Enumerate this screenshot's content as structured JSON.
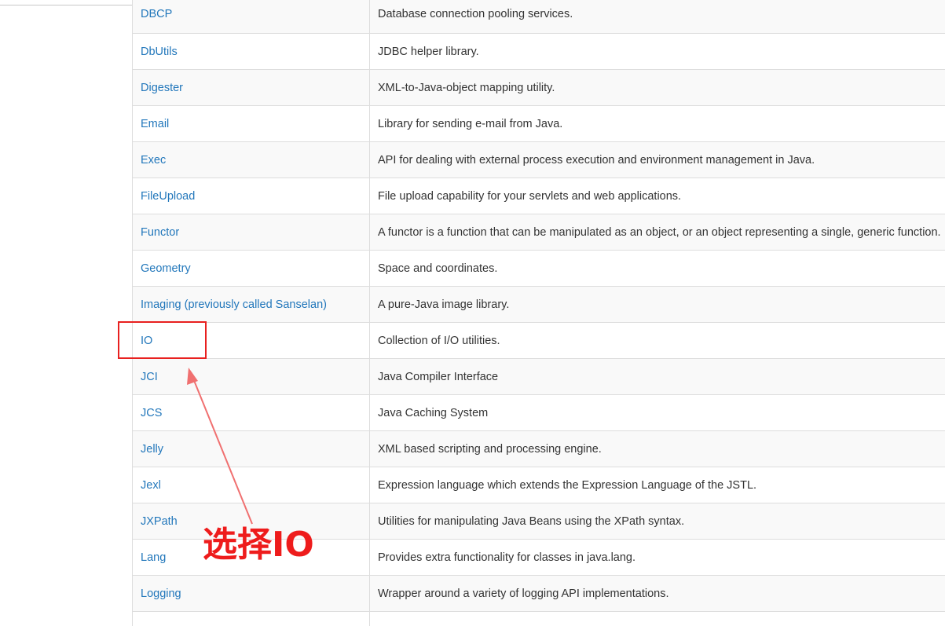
{
  "table": {
    "rows": [
      {
        "name": "DBCP",
        "description": "Database connection pooling services."
      },
      {
        "name": "DbUtils",
        "description": "JDBC helper library."
      },
      {
        "name": "Digester",
        "description": "XML-to-Java-object mapping utility."
      },
      {
        "name": "Email",
        "description": "Library for sending e-mail from Java."
      },
      {
        "name": "Exec",
        "description": "API for dealing with external process execution and environment management in Java."
      },
      {
        "name": "FileUpload",
        "description": "File upload capability for your servlets and web applications."
      },
      {
        "name": "Functor",
        "description": "A functor is a function that can be manipulated as an object, or an object representing a single, generic function."
      },
      {
        "name": "Geometry",
        "description": "Space and coordinates."
      },
      {
        "name": "Imaging (previously called Sanselan)",
        "description": "A pure-Java image library."
      },
      {
        "name": "IO",
        "description": "Collection of I/O utilities."
      },
      {
        "name": "JCI",
        "description": "Java Compiler Interface"
      },
      {
        "name": "JCS",
        "description": "Java Caching System"
      },
      {
        "name": "Jelly",
        "description": "XML based scripting and processing engine."
      },
      {
        "name": "Jexl",
        "description": "Expression language which extends the Expression Language of the JSTL."
      },
      {
        "name": "JXPath",
        "description": "Utilities for manipulating Java Beans using the XPath syntax."
      },
      {
        "name": "Lang",
        "description": "Provides extra functionality for classes in java.lang."
      },
      {
        "name": "Logging",
        "description": "Wrapper around a variety of logging API implementations."
      },
      {
        "name": "",
        "description": ""
      }
    ]
  },
  "annotation": {
    "label": "选择IO",
    "color": "#ee1c1c",
    "arrow_color": "#f07070"
  },
  "colors": {
    "link": "#2277bb",
    "text": "#333333",
    "row_alt": "#f9f9f9",
    "border": "#dddddd"
  }
}
